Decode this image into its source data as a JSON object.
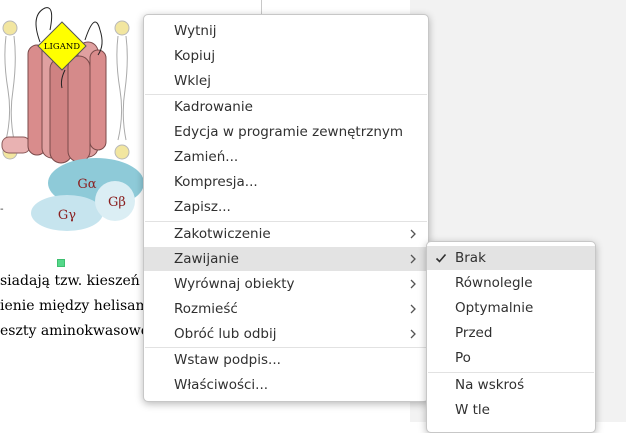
{
  "document": {
    "diagram": {
      "ligand_label": "LIGAND",
      "g_alpha": "Gα",
      "g_beta": "Gβ",
      "g_gamma": "Gγ"
    },
    "lines": [
      "siadają tzw. kieszeń w",
      "ienie między helisam",
      "eszty aminokwasowe "
    ]
  },
  "context_menu": {
    "items": [
      {
        "label": "Wytnij"
      },
      {
        "label": "Kopiuj"
      },
      {
        "label": "Wklej"
      },
      {
        "label": "Kadrowanie"
      },
      {
        "label": "Edycja w programie zewnętrznym"
      },
      {
        "label": "Zamień..."
      },
      {
        "label": "Kompresja..."
      },
      {
        "label": "Zapisz..."
      },
      {
        "label": "Zakotwiczenie"
      },
      {
        "label": "Zawijanie"
      },
      {
        "label": "Wyrównaj obiekty"
      },
      {
        "label": "Rozmieść"
      },
      {
        "label": "Obróć lub odbij"
      },
      {
        "label": "Wstaw podpis..."
      },
      {
        "label": "Właściwości..."
      }
    ]
  },
  "wrap_submenu": {
    "items": [
      {
        "label": "Brak",
        "checked": true
      },
      {
        "label": "Równolegle"
      },
      {
        "label": "Optymalnie"
      },
      {
        "label": "Przed"
      },
      {
        "label": "Po"
      },
      {
        "label": "Na wskroś"
      },
      {
        "label": "W tle"
      }
    ]
  },
  "colors": {
    "highlight": "#e3e3e3",
    "cylinder": "#d98c8c",
    "ligand": "#ffff00",
    "g_alpha": "#8ecad8",
    "g_gamma": "#c6e4ee"
  }
}
